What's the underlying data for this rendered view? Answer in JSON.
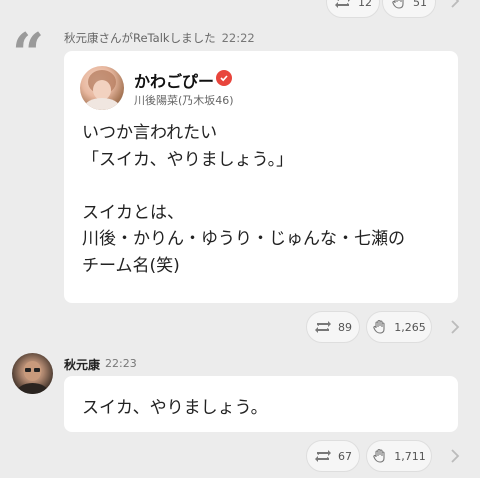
{
  "top_actions": {
    "retalk_count": "12",
    "like_count": "51"
  },
  "retalk_post": {
    "retalk_notice": "秋元康さんがReTalkしました",
    "retalk_time": "22:22",
    "author_name": "かわごぴー",
    "author_sub": "川後陽菜(乃木坂46)",
    "body": "いつか言われたい\n「スイカ、やりましょう。」\n\nスイカとは、\n川後・かりん・ゆうり・じゅんな・七瀬の\nチーム名(笑)",
    "retalk_count": "89",
    "like_count": "1,265"
  },
  "reply_post": {
    "author_name": "秋元康",
    "time": "22:23",
    "body": "スイカ、やりましょう。",
    "retalk_count": "67",
    "like_count": "1,711"
  },
  "icons": {
    "quote": "quote-mark-icon",
    "retalk": "retalk-icon",
    "like": "clap-hand-icon",
    "chevron": "chevron-right-icon",
    "verified": "verified-check-icon"
  },
  "colors": {
    "background": "#ececec",
    "card": "#ffffff",
    "verified": "#e8453c",
    "muted_text": "#666666"
  }
}
